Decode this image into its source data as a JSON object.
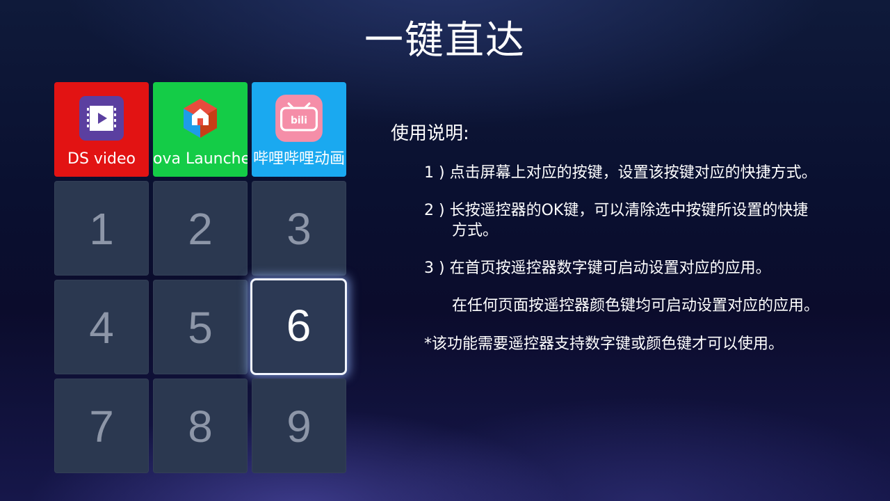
{
  "title": "一键直达",
  "apps": [
    {
      "label": "DS video",
      "icon": "ds-video-icon",
      "color": "#e21313"
    },
    {
      "label": "ova Launche",
      "icon": "nova-launcher-icon",
      "color": "#14cc47"
    },
    {
      "label": "哔哩哔哩动画",
      "icon": "bilibili-icon",
      "color": "#1aa9f0"
    }
  ],
  "keys": [
    {
      "label": "1"
    },
    {
      "label": "2"
    },
    {
      "label": "3"
    },
    {
      "label": "4"
    },
    {
      "label": "5"
    },
    {
      "label": "6",
      "focused": true
    },
    {
      "label": "7"
    },
    {
      "label": "8"
    },
    {
      "label": "9"
    }
  ],
  "instructions": {
    "heading": "使用说明:",
    "item1": "1 ) 点击屏幕上对应的按键，设置该按键对应的快捷方式。",
    "item2_line1": "2 ) 长按遥控器的OK键，可以清除选中按键所设置的快捷",
    "item2_line2": "方式。",
    "item3": "3 ) 在首页按遥控器数字键可启动设置对应的应用。",
    "item3_extra": "在任何页面按遥控器颜色键均可启动设置对应的应用。",
    "note": "*该功能需要遥控器支持数字键或颜色键才可以使用。"
  },
  "colors": {
    "tile_bg": "#2b3850",
    "tile_text": "#8d96a8",
    "focus_border": "#f2f5ff"
  }
}
